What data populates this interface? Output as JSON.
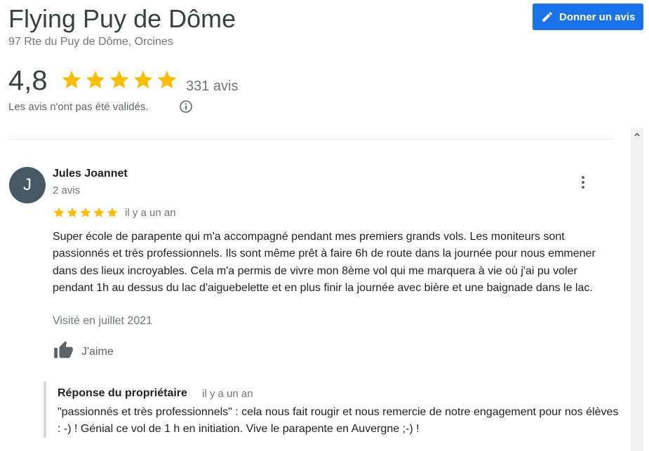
{
  "business": {
    "name": "Flying Puy de Dôme",
    "address": "97 Rte du Puy de Dôme, Orcines"
  },
  "write_review_button": {
    "label": "Donner un avis",
    "icon": "pencil-icon"
  },
  "summary": {
    "rating": "4,8",
    "stars": 5,
    "review_count": "331 avis",
    "notice": "Les avis n'ont pas été validés.",
    "info_icon": "info-icon"
  },
  "review": {
    "avatar_letter": "J",
    "author": "Jules Joannet",
    "author_reviews": "2 avis",
    "stars": 5,
    "time": "il y a un an",
    "text": "Super école de parapente qui m'a accompagné pendant mes premiers grands vols. Les moniteurs sont passionnés et très professionnels. Ils sont même prêt à faire 6h de route dans la journée pour nous emmener dans des lieux incroyables. Cela m'a permis de vivre mon 8ème vol qui me marquera à vie où j'ai pu voler pendant 1h au dessus du lac d'aiguebelette et en plus finir la journée avec bière et une baignade dans le lac.",
    "visited": "Visité en juillet 2021",
    "like_label": "J'aime",
    "owner_reply": {
      "title": "Réponse du propriétaire",
      "time": "il y a un an",
      "text": "\"passionnés et très professionnels\" : cela nous fait rougir et nous remercie de notre engagement pour nos élèves : -) ! Génial ce vol de 1 h en initiation. Vive le parapente en Auvergne ;-) !"
    }
  },
  "colors": {
    "star": "#fbbc04",
    "button_bg": "#1a73e8",
    "avatar_bg": "#455a64"
  }
}
